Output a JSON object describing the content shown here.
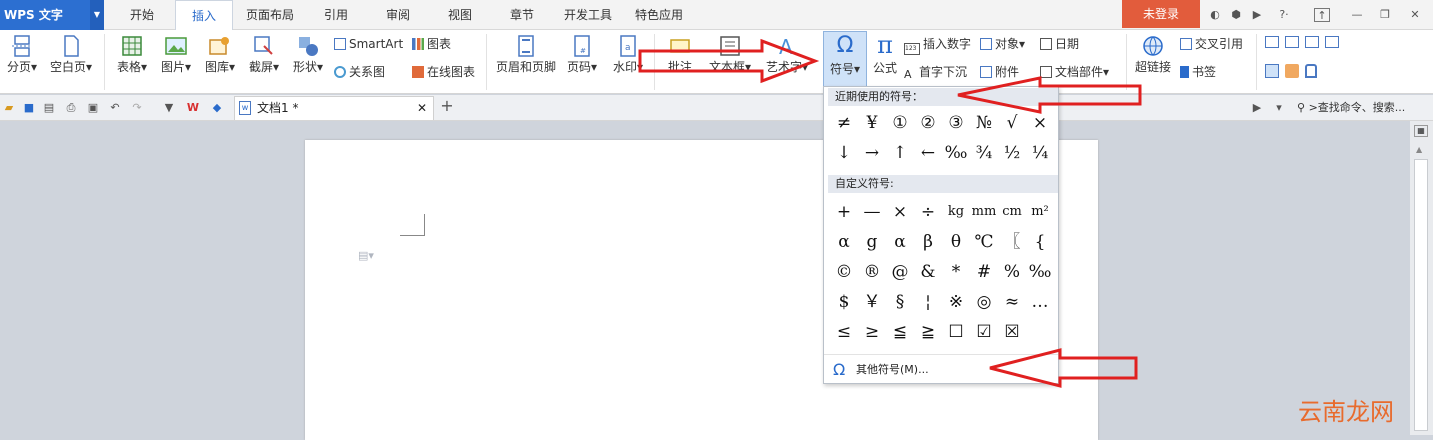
{
  "app": {
    "name": "WPS 文字"
  },
  "menu_tabs": [
    "开始",
    "插入",
    "页面布局",
    "引用",
    "审阅",
    "视图",
    "章节",
    "开发工具",
    "特色应用"
  ],
  "active_tab": "插入",
  "login": "未登录",
  "ribbon": {
    "big_buttons": {
      "page_break": "分页",
      "blank_page": "空白页",
      "table": "表格",
      "picture": "图片",
      "gallery": "图库",
      "screenshot": "截屏",
      "shape": "形状",
      "header_footer": "页眉和页脚",
      "page_number": "页码",
      "watermark": "水印",
      "comment": "批注",
      "textbox": "文本框",
      "wordart": "艺术字",
      "symbol": "符号",
      "formula": "公式",
      "hyperlink": "超链接"
    },
    "small_buttons": {
      "smartart": "SmartArt",
      "chart": "图表",
      "relation": "关系图",
      "online_chart": "在线图表",
      "insert_number": "插入数字",
      "object": "对象",
      "date": "日期",
      "dropcap": "首字下沉",
      "attachment": "附件",
      "doc_parts": "文档部件",
      "cross_ref": "交叉引用",
      "bookmark": "书签"
    }
  },
  "doc_tab": {
    "title": "文档1 *"
  },
  "search": {
    "placeholder": ">查找命令、搜索..."
  },
  "symbol_menu": {
    "recent_header": "近期使用的符号：",
    "recent": [
      "≠",
      "¥",
      "①",
      "②",
      "③",
      "№",
      "√",
      "×",
      "↓",
      "→",
      "↑",
      "←",
      "‰",
      "¾",
      "½",
      "¼"
    ],
    "custom_header": "自定义符号:",
    "custom": [
      "+",
      "—",
      "×",
      "÷",
      "kg",
      "mm",
      "cm",
      "m²",
      "α",
      "g",
      "α",
      "β",
      "θ",
      "℃",
      "〖",
      "{",
      "©",
      "®",
      "@",
      "&",
      "*",
      "#",
      "%",
      "‰",
      "$",
      "￥",
      "§",
      "¦",
      "※",
      "◎",
      "≈",
      "…",
      "≤",
      "≥",
      "≦",
      "≧",
      "☐",
      "☑",
      "☒"
    ],
    "more": "其他符号(M)..."
  },
  "watermark": {
    "text": "云南龙网"
  },
  "colors": {
    "accent": "#2c6fd1",
    "login_bg": "#e25c3c",
    "arrow": "#e02020"
  }
}
